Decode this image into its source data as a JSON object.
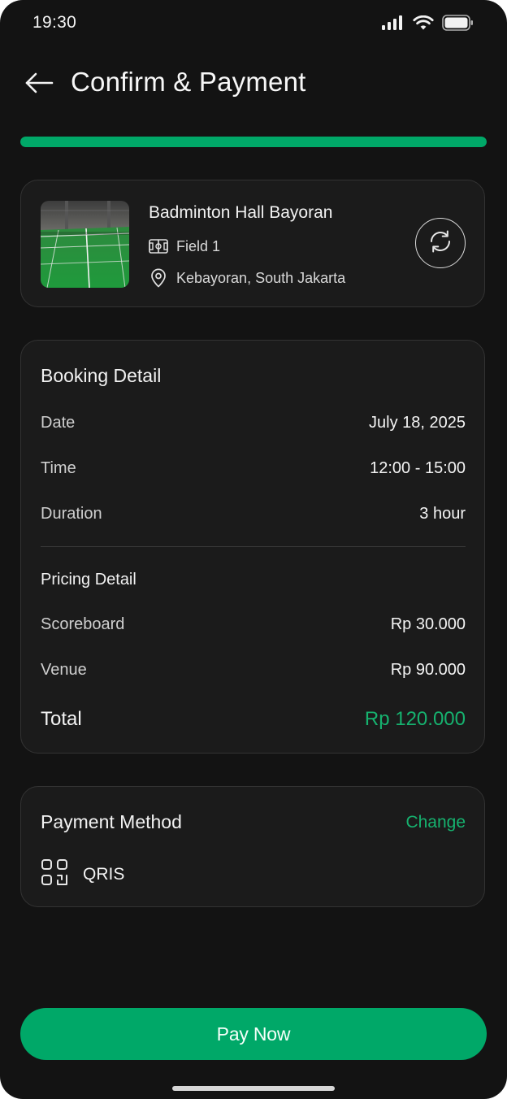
{
  "status_bar": {
    "time": "19:30",
    "icons": [
      "signal-icon",
      "wifi-icon",
      "battery-icon"
    ]
  },
  "header": {
    "title": "Confirm & Payment",
    "back_icon": "arrow-left-icon"
  },
  "progress": {
    "value": 1.0,
    "color": "#00a868"
  },
  "venue": {
    "name": "Badminton Hall Bayoran",
    "field": "Field 1",
    "location": "Kebayoran, South Jakarta",
    "field_icon": "court-icon",
    "location_icon": "location-pin-icon",
    "action_icon": "refresh-icon"
  },
  "booking": {
    "title": "Booking Detail",
    "rows": [
      {
        "label": "Date",
        "value": "July 18, 2025"
      },
      {
        "label": "Time",
        "value": "12:00 - 15:00"
      },
      {
        "label": "Duration",
        "value": "3 hour"
      }
    ],
    "pricing": {
      "title": "Pricing Detail",
      "rows": [
        {
          "label": "Scoreboard",
          "value": "Rp 30.000"
        },
        {
          "label": "Venue",
          "value": "Rp 90.000"
        }
      ],
      "total_label": "Total",
      "total_value": "Rp 120.000"
    }
  },
  "payment": {
    "title": "Payment Method",
    "change_label": "Change",
    "method": "QRIS",
    "method_icon": "qr-code-icon"
  },
  "actions": {
    "pay_label": "Pay Now"
  },
  "colors": {
    "accent": "#00a868",
    "accent_text": "#16b26f",
    "background": "#131313",
    "card": "#1b1b1b"
  }
}
